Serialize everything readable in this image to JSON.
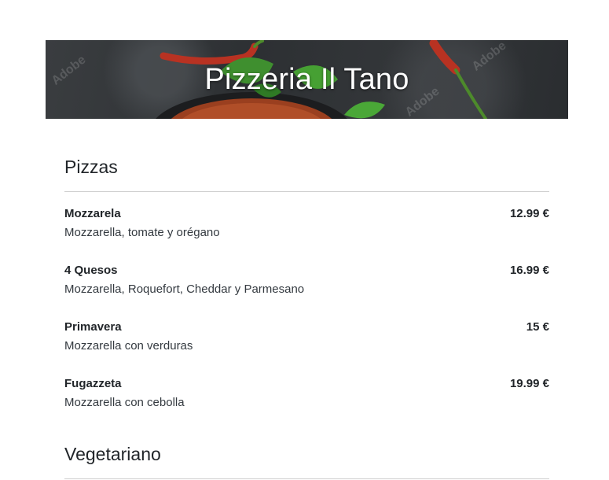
{
  "header": {
    "title": "Pizzeria Il Tano",
    "watermark": "Adobe"
  },
  "menu": {
    "sections": [
      {
        "title": "Pizzas",
        "items": [
          {
            "name": "Mozzarela",
            "description": "Mozzarella, tomate y orégano",
            "price": "12.99 €"
          },
          {
            "name": "4 Quesos",
            "description": "Mozzarella, Roquefort, Cheddar y Parmesano",
            "price": "16.99 €"
          },
          {
            "name": "Primavera",
            "description": "Mozzarella con verduras",
            "price": "15 €"
          },
          {
            "name": "Fugazzeta",
            "description": "Mozzarella con cebolla",
            "price": "19.99 €"
          }
        ]
      },
      {
        "title": "Vegetariano",
        "items": []
      }
    ]
  },
  "colors": {
    "text": "#212529",
    "hero_title": "#ffffff",
    "divider": "#cfcfcf",
    "chili": "#c0392b",
    "basil": "#3f8f2f"
  }
}
